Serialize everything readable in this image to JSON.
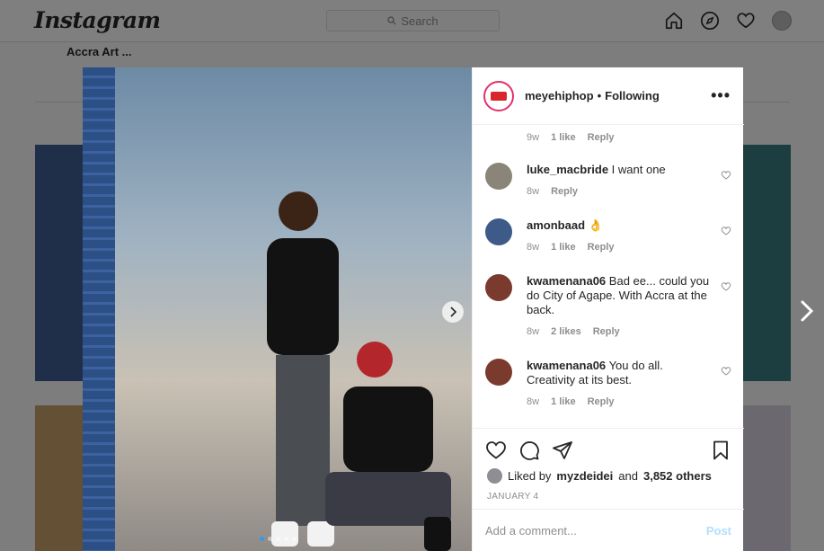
{
  "app": {
    "logo": "Instagram"
  },
  "search": {
    "placeholder": "Search"
  },
  "profile": {
    "breadcrumb": "Accra Art ..."
  },
  "post": {
    "owner": "meyehiphop",
    "separator": "•",
    "follow_status": "Following",
    "more": "•••",
    "carousel": {
      "slides": 5,
      "active": 1
    }
  },
  "comments": [
    {
      "user": "",
      "text": "",
      "time": "9w",
      "likes": "1 like",
      "reply": "Reply",
      "avatar_color": "#ffffff"
    },
    {
      "user": "luke_macbride",
      "text": "I want one",
      "time": "8w",
      "likes": "",
      "reply": "Reply",
      "avatar_color": "#8a8578"
    },
    {
      "user": "amonbaad",
      "text": "👌",
      "time": "8w",
      "likes": "1 like",
      "reply": "Reply",
      "avatar_color": "#3e5a88"
    },
    {
      "user": "kwamenana06",
      "text": "Bad ee... could you do City of Agape. With Accra at the back.",
      "time": "8w",
      "likes": "2 likes",
      "reply": "Reply",
      "avatar_color": "#7a3b2e"
    },
    {
      "user": "kwamenana06",
      "text": "You do all. Creativity at its best.",
      "time": "8w",
      "likes": "1 like",
      "reply": "Reply",
      "avatar_color": "#7a3b2e"
    }
  ],
  "likes": {
    "prefix": "Liked by",
    "user": "myzdeidei",
    "and": "and",
    "others": "3,852 others"
  },
  "date": "JANUARY 4",
  "add_comment": {
    "placeholder": "Add a comment...",
    "post_label": "Post"
  },
  "colors": {
    "accent": "#3897f0",
    "post_disabled": "#b2dffc",
    "brand_red": "#d9262c"
  }
}
